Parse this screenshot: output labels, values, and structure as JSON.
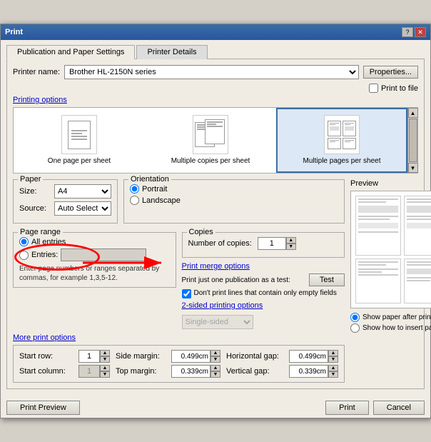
{
  "window": {
    "title": "Print"
  },
  "tabs": [
    {
      "id": "pub-paper",
      "label": "Publication and Paper Settings",
      "active": true
    },
    {
      "id": "printer-details",
      "label": "Printer Details",
      "active": false
    }
  ],
  "printer": {
    "label": "Printer name:",
    "value": "Brother HL-2150N series",
    "properties_btn": "Properties...",
    "print_to_file_label": "Print to file"
  },
  "printing_options": {
    "link_label": "Printing options",
    "layouts": [
      {
        "id": "one-page",
        "label": "One page per sheet",
        "selected": false
      },
      {
        "id": "multi-copies",
        "label": "Multiple copies per sheet",
        "selected": false
      },
      {
        "id": "multi-pages",
        "label": "Multiple pages per sheet",
        "selected": true
      }
    ]
  },
  "paper": {
    "title": "Paper",
    "size_label": "Size:",
    "size_value": "A4",
    "source_label": "Source:",
    "source_value": "Auto Select"
  },
  "orientation": {
    "title": "Orientation",
    "portrait_label": "Portrait",
    "landscape_label": "Landscape",
    "selected": "portrait"
  },
  "page_range": {
    "title": "Page range",
    "all_entries_label": "All entries",
    "entries_label": "Entries:",
    "entries_placeholder": "",
    "hint": "Enter page numbers or ranges separated by commas, for example 1,3,5-12."
  },
  "copies": {
    "title": "Copies",
    "number_label": "Number of copies:",
    "value": "1"
  },
  "print_merge": {
    "link_label": "Print merge options",
    "just_one_label": "Print just one publication as a test:",
    "test_btn": "Test",
    "dont_print_label": "Don't print lines that contain only empty fields"
  },
  "two_sided": {
    "link_label": "2-sided printing options",
    "value": "Single-sided"
  },
  "preview": {
    "title": "Preview",
    "show_paper_label": "Show paper after printing",
    "show_insert_label": "Show how to insert paper",
    "selected": "show_paper"
  },
  "more_options": {
    "link_label": "More print options"
  },
  "margins": {
    "start_row_label": "Start row:",
    "start_row_value": "1",
    "start_col_label": "Start column:",
    "start_col_value": "1",
    "side_margin_label": "Side margin:",
    "side_margin_value": "0.499cm",
    "top_margin_label": "Top margin:",
    "top_margin_value": "0.339cm",
    "h_gap_label": "Horizontal gap:",
    "h_gap_value": "0.499cm",
    "v_gap_label": "Vertical gap:",
    "v_gap_value": "0.339cm"
  },
  "footer": {
    "preview_btn": "Print Preview",
    "print_btn": "Print",
    "cancel_btn": "Cancel"
  }
}
